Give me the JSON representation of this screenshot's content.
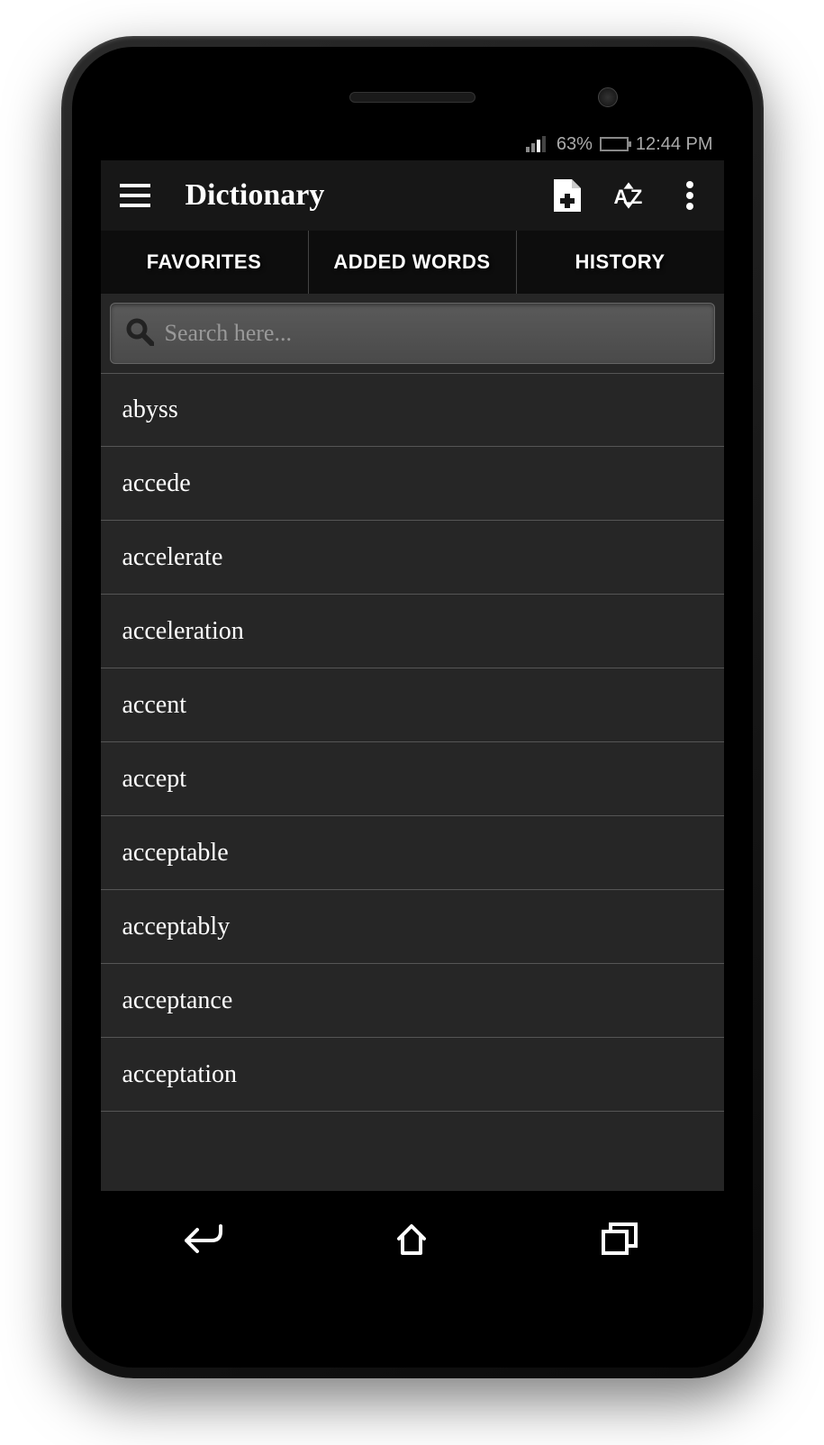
{
  "statusBar": {
    "battery": "63%",
    "time": "12:44 PM"
  },
  "appBar": {
    "title": "Dictionary"
  },
  "tabs": [
    {
      "label": "FAVORITES"
    },
    {
      "label": "ADDED WORDS"
    },
    {
      "label": "HISTORY"
    }
  ],
  "search": {
    "placeholder": "Search here..."
  },
  "words": [
    "abyss",
    "accede",
    "accelerate",
    "acceleration",
    "accent",
    "accept",
    "acceptable",
    "acceptably",
    "acceptance",
    "acceptation"
  ]
}
